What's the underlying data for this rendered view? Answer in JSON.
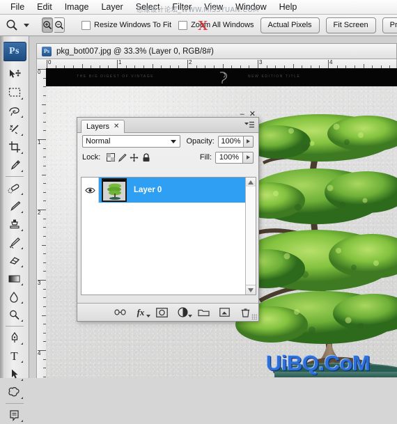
{
  "app": {
    "name": "Adobe Photoshop",
    "logo_text": "Ps"
  },
  "menubar": {
    "items": [
      {
        "label": "File",
        "name": "menu-file"
      },
      {
        "label": "Edit",
        "name": "menu-edit"
      },
      {
        "label": "Image",
        "name": "menu-image"
      },
      {
        "label": "Layer",
        "name": "menu-layer"
      },
      {
        "label": "Select",
        "name": "menu-select"
      },
      {
        "label": "Filter",
        "name": "menu-filter"
      },
      {
        "label": "View",
        "name": "menu-view"
      },
      {
        "label": "Window",
        "name": "menu-window"
      },
      {
        "label": "Help",
        "name": "menu-help"
      }
    ]
  },
  "options_bar": {
    "active_tool_icon": "zoom-tool-icon",
    "zoom_in_icon": "zoom-in-icon",
    "zoom_out_icon": "zoom-out-icon",
    "resize_windows_label": "Resize Windows To Fit",
    "resize_windows_checked": false,
    "zoom_all_windows_label": "Zoom All Windows",
    "zoom_all_windows_checked": false,
    "actual_pixels_label": "Actual Pixels",
    "fit_screen_label": "Fit Screen",
    "print_size_label": "Print Size"
  },
  "toolbox": {
    "tools": [
      {
        "name": "move-tool",
        "icon": "move-icon"
      },
      {
        "name": "marquee-tool",
        "icon": "rectangular-marquee-icon"
      },
      {
        "name": "lasso-tool",
        "icon": "lasso-icon"
      },
      {
        "name": "magic-wand-tool",
        "icon": "magic-wand-icon"
      },
      {
        "name": "crop-tool",
        "icon": "crop-icon"
      },
      {
        "name": "eyedropper-tool",
        "icon": "eyedropper-icon"
      },
      {
        "name": "healing-brush-tool",
        "icon": "healing-brush-icon"
      },
      {
        "name": "brush-tool",
        "icon": "brush-icon"
      },
      {
        "name": "clone-stamp-tool",
        "icon": "clone-stamp-icon"
      },
      {
        "name": "history-brush-tool",
        "icon": "history-brush-icon"
      },
      {
        "name": "eraser-tool",
        "icon": "eraser-icon"
      },
      {
        "name": "gradient-tool",
        "icon": "gradient-icon"
      },
      {
        "name": "blur-tool",
        "icon": "blur-icon"
      },
      {
        "name": "dodge-tool",
        "icon": "dodge-icon"
      },
      {
        "name": "pen-tool",
        "icon": "pen-icon"
      },
      {
        "name": "type-tool",
        "icon": "type-icon",
        "glyph": "T"
      },
      {
        "name": "path-selection-tool",
        "icon": "path-selection-icon"
      },
      {
        "name": "shape-tool",
        "icon": "custom-shape-icon"
      },
      {
        "name": "notes-tool",
        "icon": "notes-icon"
      }
    ]
  },
  "document": {
    "title": "pkg_bot007.jpg @ 33.3% (Layer 0, RGB/8#)",
    "filename": "pkg_bot007.jpg",
    "zoom": "33.3%",
    "layer": "Layer 0",
    "mode": "RGB/8#",
    "ruler_h_labels": [
      "0",
      "1",
      "2",
      "3",
      "4"
    ],
    "ruler_v_labels": [
      "0",
      "1",
      "2",
      "3",
      "4"
    ],
    "banner_text_left": "THE BIG DIGEST OF VINTAGE",
    "banner_text_right": "NEW EDITION TITLE"
  },
  "layers_panel": {
    "tab_label": "Layers",
    "tab_close_glyph": "✕",
    "minimize_glyph": "–",
    "close_glyph": "✕",
    "blend_mode": "Normal",
    "opacity_label": "Opacity:",
    "opacity_value": "100%",
    "fill_label": "Fill:",
    "fill_value": "100%",
    "lock_label": "Lock:",
    "lock_icons": [
      {
        "name": "lock-transparent-pixels-icon"
      },
      {
        "name": "lock-image-pixels-icon"
      },
      {
        "name": "lock-position-icon"
      },
      {
        "name": "lock-all-icon"
      }
    ],
    "layers": [
      {
        "name": "Layer 0",
        "visible": true,
        "selected": true
      }
    ],
    "bottom_icons": [
      {
        "name": "link-layers-icon"
      },
      {
        "name": "layer-style-fx-icon",
        "glyph": "fx"
      },
      {
        "name": "add-layer-mask-icon"
      },
      {
        "name": "new-adjustment-layer-icon"
      },
      {
        "name": "new-group-icon"
      },
      {
        "name": "new-layer-icon"
      },
      {
        "name": "delete-layer-icon"
      }
    ]
  },
  "watermarks": {
    "top": "思缘设计论坛_WWW.MISSYUAN.COM",
    "bottom": "UiBQ.CoM",
    "x_mark": "X"
  },
  "colors": {
    "selection_blue": "#2e9ff2",
    "accent_blue": "#2f6fd8",
    "panel_bg": "#e8e8e8",
    "toolbar_bg": "#ededed",
    "watermark_red": "#d0242a"
  }
}
